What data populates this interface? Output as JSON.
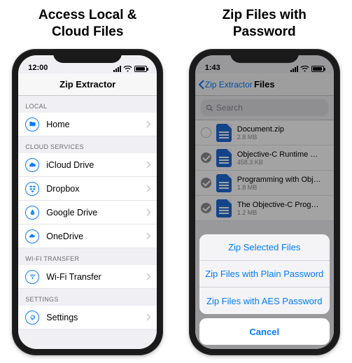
{
  "left": {
    "title_l1": "Access Local &",
    "title_l2": "Cloud Files",
    "time": "12:00",
    "nav_title": "Zip Extractor",
    "sections": {
      "local": {
        "header": "LOCAL",
        "items": [
          {
            "label": "Home",
            "icon": "folder"
          }
        ]
      },
      "cloud": {
        "header": "CLOUD SERVICES",
        "items": [
          {
            "label": "iCloud Drive",
            "icon": "cloud"
          },
          {
            "label": "Dropbox",
            "icon": "dropbox"
          },
          {
            "label": "Google Drive",
            "icon": "gdrive"
          },
          {
            "label": "OneDrive",
            "icon": "onedrive"
          }
        ]
      },
      "wifi": {
        "header": "WI-FI TRANSFER",
        "items": [
          {
            "label": "Wi-Fi Transfer",
            "icon": "wifi"
          }
        ]
      },
      "settings": {
        "header": "SETTINGS",
        "items": [
          {
            "label": "Settings",
            "icon": "gear"
          }
        ]
      }
    }
  },
  "right": {
    "title_l1": "Zip Files with",
    "title_l2": "Password",
    "time": "1:43",
    "nav_back": "Zip Extractor",
    "nav_title": "Files",
    "search_placeholder": "Search",
    "files": [
      {
        "name": "Document.zip",
        "size": "2.8 MB",
        "selected": false
      },
      {
        "name": "Objective-C Runtime Refe...",
        "size": "458.3 KB",
        "selected": true
      },
      {
        "name": "Programming with Objecti...",
        "size": "1.8 MB",
        "selected": true
      },
      {
        "name": "The Objective-C Program...",
        "size": "1.2 MB",
        "selected": true
      }
    ],
    "sheet": {
      "actions": [
        "Zip Selected Files",
        "Zip Files with Plain Password",
        "Zip Files with AES Password"
      ],
      "cancel": "Cancel"
    }
  },
  "colors": {
    "accent": "#007aff",
    "icon_ring": "#0a7cff"
  }
}
